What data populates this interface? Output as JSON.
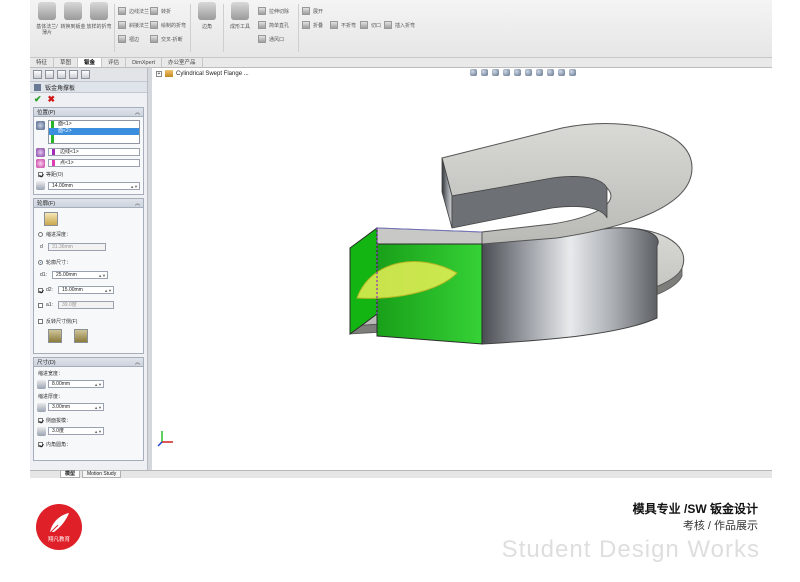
{
  "ribbon": {
    "big_buttons": [
      "基体法兰/薄片",
      "转换到钣金",
      "放样的折弯"
    ],
    "small_buttons": [
      "边线法兰",
      "斜接法兰",
      "褶边",
      "绘制的折弯",
      "交叉-折断",
      "转折"
    ],
    "big_buttons_2": [
      "边角",
      "成形工具",
      "拉伸切除",
      "简单直孔",
      "通风口"
    ],
    "small_buttons_2": [
      "展开",
      "折叠",
      "不折弯",
      "插入折弯",
      "切口"
    ]
  },
  "tabs": [
    "特征",
    "草图",
    "钣金",
    "评估",
    "DimXpert",
    "办公室产品"
  ],
  "active_tab": "钣金",
  "panel": {
    "title": "钣金角撑板",
    "section_position": {
      "title": "位置(P)",
      "faces": [
        "面<1>",
        "面<2>"
      ],
      "edge": "边线<1>",
      "point": "点<1>",
      "offset_checkbox": "等距(O)",
      "offset_value": "14.00mm"
    },
    "section_profile": {
      "title": "轮廓(F)",
      "option_depth": "缩进深度：",
      "depth_value": "31.36mm",
      "option_size": "轮廓尺寸：",
      "d1_label": "d1:",
      "d1_value": "25.00mm",
      "d2_label": "d2:",
      "d2_value": "15.00mm",
      "a1_label": "a1:",
      "a1_value": "39.0度",
      "flip_checkbox": "反转尺寸侧(F)"
    },
    "section_dimensions": {
      "title": "尺寸(D)",
      "width_label": "缩进宽度：",
      "width_value": "8.00mm",
      "thickness_label": "缩进厚度：",
      "thickness_value": "3.00mm",
      "draft_label": "侧面拔模：",
      "draft_value": "3.0度",
      "fillet_label": "内角圆角："
    }
  },
  "viewport": {
    "tree_item": "Cylindrical Swept Flange ..."
  },
  "bottom_tabs": [
    "模型",
    "Motion Study"
  ],
  "footer": {
    "title": "模具专业 /SW 钣金设计",
    "subtitle": "考核 / 作品展示",
    "watermark": "Student Design Works",
    "logo_text": "翔凡教育"
  },
  "colors": {
    "selection_green": "#2bbf2b",
    "logo_red": "#e02028",
    "ok_green": "#24a124",
    "cancel_red": "#d01818"
  }
}
